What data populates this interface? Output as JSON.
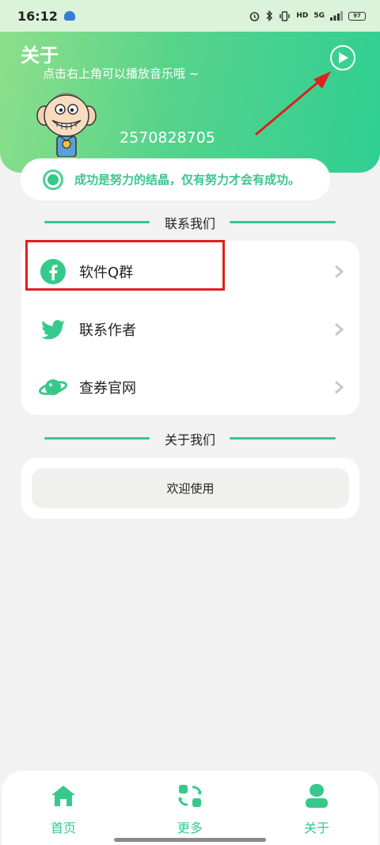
{
  "status_bar": {
    "time": "16:12",
    "icons": [
      "weather-icon",
      "alarm-icon",
      "bluetooth-icon",
      "vibrate-icon",
      "hd-icon",
      "5g-icon",
      "signal-icon",
      "battery-icon"
    ],
    "hd_text": "HD",
    "net_text": "5G",
    "battery_text": "97"
  },
  "header": {
    "title": "关于",
    "subtitle": "点击右上角可以播放音乐哦 ~",
    "user_id": "2570828705",
    "play_icon": "play-circle-icon"
  },
  "motto": {
    "text": "成功是努力的结晶，仅有努力才会有成功。"
  },
  "contact_section": {
    "title": "联系我们",
    "items": [
      {
        "label": "软件Q群",
        "icon": "facebook-icon"
      },
      {
        "label": "联系作者",
        "icon": "twitter-bird-icon"
      },
      {
        "label": "查券官网",
        "icon": "planet-icon"
      }
    ]
  },
  "about_section": {
    "title": "关于我们",
    "button_label": "欢迎使用"
  },
  "tabbar": {
    "tabs": [
      {
        "label": "首页",
        "icon": "home-icon"
      },
      {
        "label": "更多",
        "icon": "grid-refresh-icon"
      },
      {
        "label": "关于",
        "icon": "user-icon"
      }
    ]
  },
  "colors": {
    "accent": "#36c98c",
    "highlight_box": "#e02020",
    "annotation_arrow": "#e02020"
  }
}
